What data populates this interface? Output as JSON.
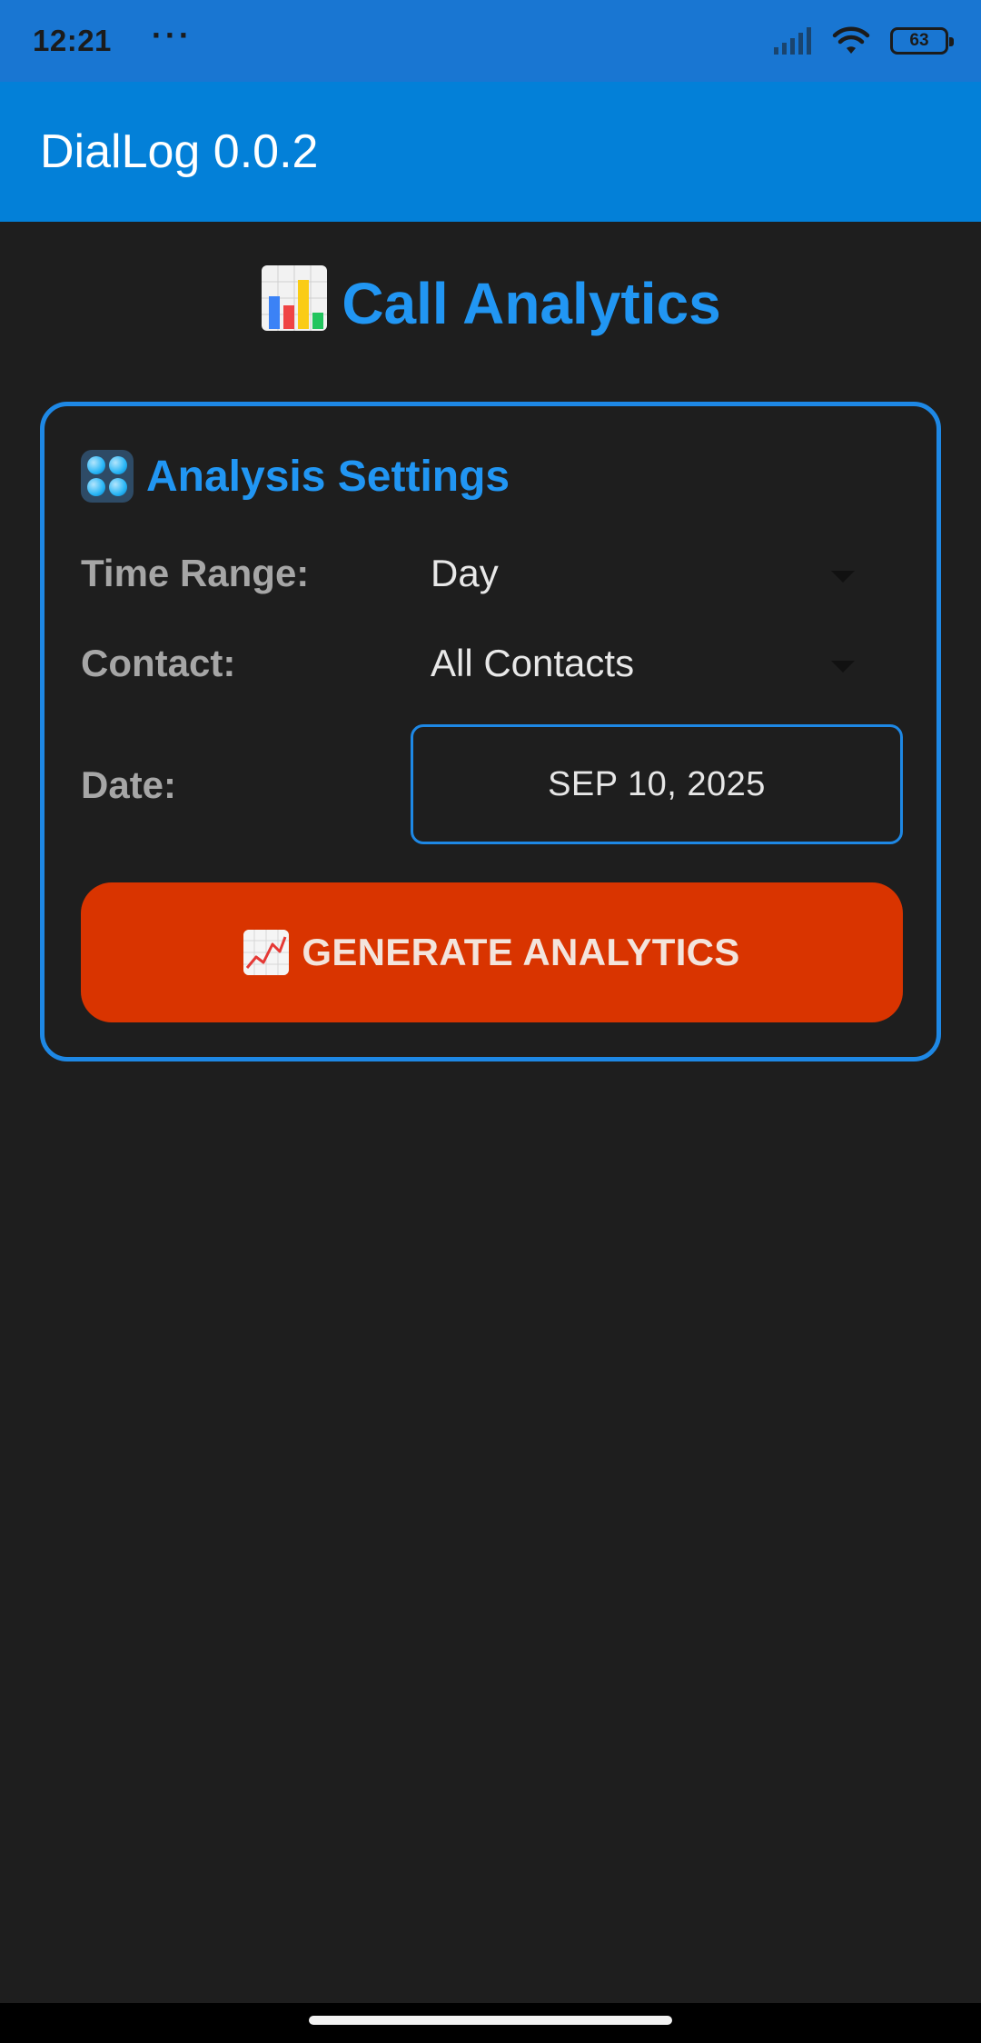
{
  "status_bar": {
    "time": "12:21",
    "dots": "···",
    "battery": "63"
  },
  "app_bar": {
    "title": "DialLog 0.0.2"
  },
  "page": {
    "heading": "Call Analytics"
  },
  "settings_card": {
    "title": "Analysis Settings",
    "time_range": {
      "label": "Time Range:",
      "value": "Day"
    },
    "contact": {
      "label": "Contact:",
      "value": "All Contacts"
    },
    "date": {
      "label": "Date:",
      "value": "SEP 10, 2025"
    },
    "generate_button": "GENERATE ANALYTICS"
  },
  "colors": {
    "status_bar": "#1976d2",
    "app_bar": "#0380d8",
    "accent": "#2196f3",
    "background": "#1e1e1e",
    "generate_button": "#d93400"
  },
  "icons": {
    "heading": "bar-chart-icon",
    "card_title": "control-knobs-icon",
    "generate_button": "chart-increasing-icon"
  }
}
